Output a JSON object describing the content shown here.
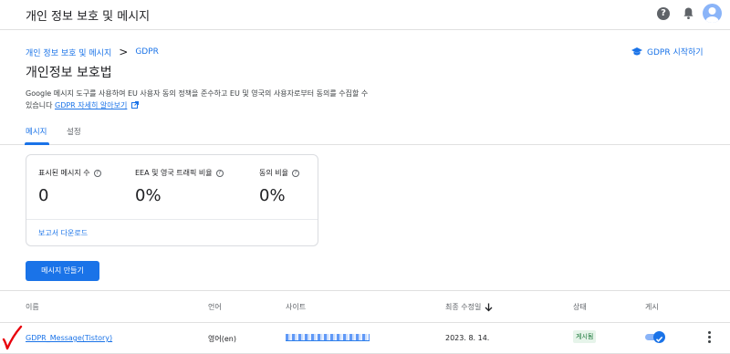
{
  "header": {
    "title": "개인 정보 보호 및 메시지",
    "help_icon": "help-circle-icon",
    "bell_icon": "notifications-icon",
    "avatar_icon": "account-avatar-icon"
  },
  "breadcrumb": {
    "parent": "개인 정보 보호 및 메시지",
    "separator": ">",
    "current": "GDPR"
  },
  "gdpr_start": {
    "label": "GDPR 시작하기",
    "icon": "graduation-cap-icon"
  },
  "page": {
    "title": "개인정보 보호법",
    "description": "Google 메시지 도구를 사용하여 EU 사용자 동의 정책을 준수하고 EU 및 영국의 사용자로부터 동의를 수집할 수 있습니다",
    "learn_more": "GDPR 자세히 알아보기"
  },
  "tabs": [
    {
      "label": "메시지",
      "active": true
    },
    {
      "label": "설정",
      "active": false
    }
  ],
  "stats": [
    {
      "label": "표시된 메시지 수",
      "value": "0"
    },
    {
      "label": "EEA 및 영국 트래픽 비율",
      "value": "0%"
    },
    {
      "label": "동의 비율",
      "value": "0%"
    }
  ],
  "report_link": "보고서 다운로드",
  "create_button": "메시지 만들기",
  "table": {
    "columns": [
      "이름",
      "언어",
      "사이트",
      "최종 수정일",
      "상태",
      "게시"
    ],
    "rows": [
      {
        "name": "GDPR_Message(Tistory)",
        "language": "영어(en)",
        "modified": "2023. 8. 14.",
        "status": "게시됨",
        "published": true
      }
    ]
  },
  "colors": {
    "accent": "#1a73e8",
    "status_bg": "#e6f4ea",
    "status_text": "#137333",
    "annotation": "#e8000b"
  }
}
